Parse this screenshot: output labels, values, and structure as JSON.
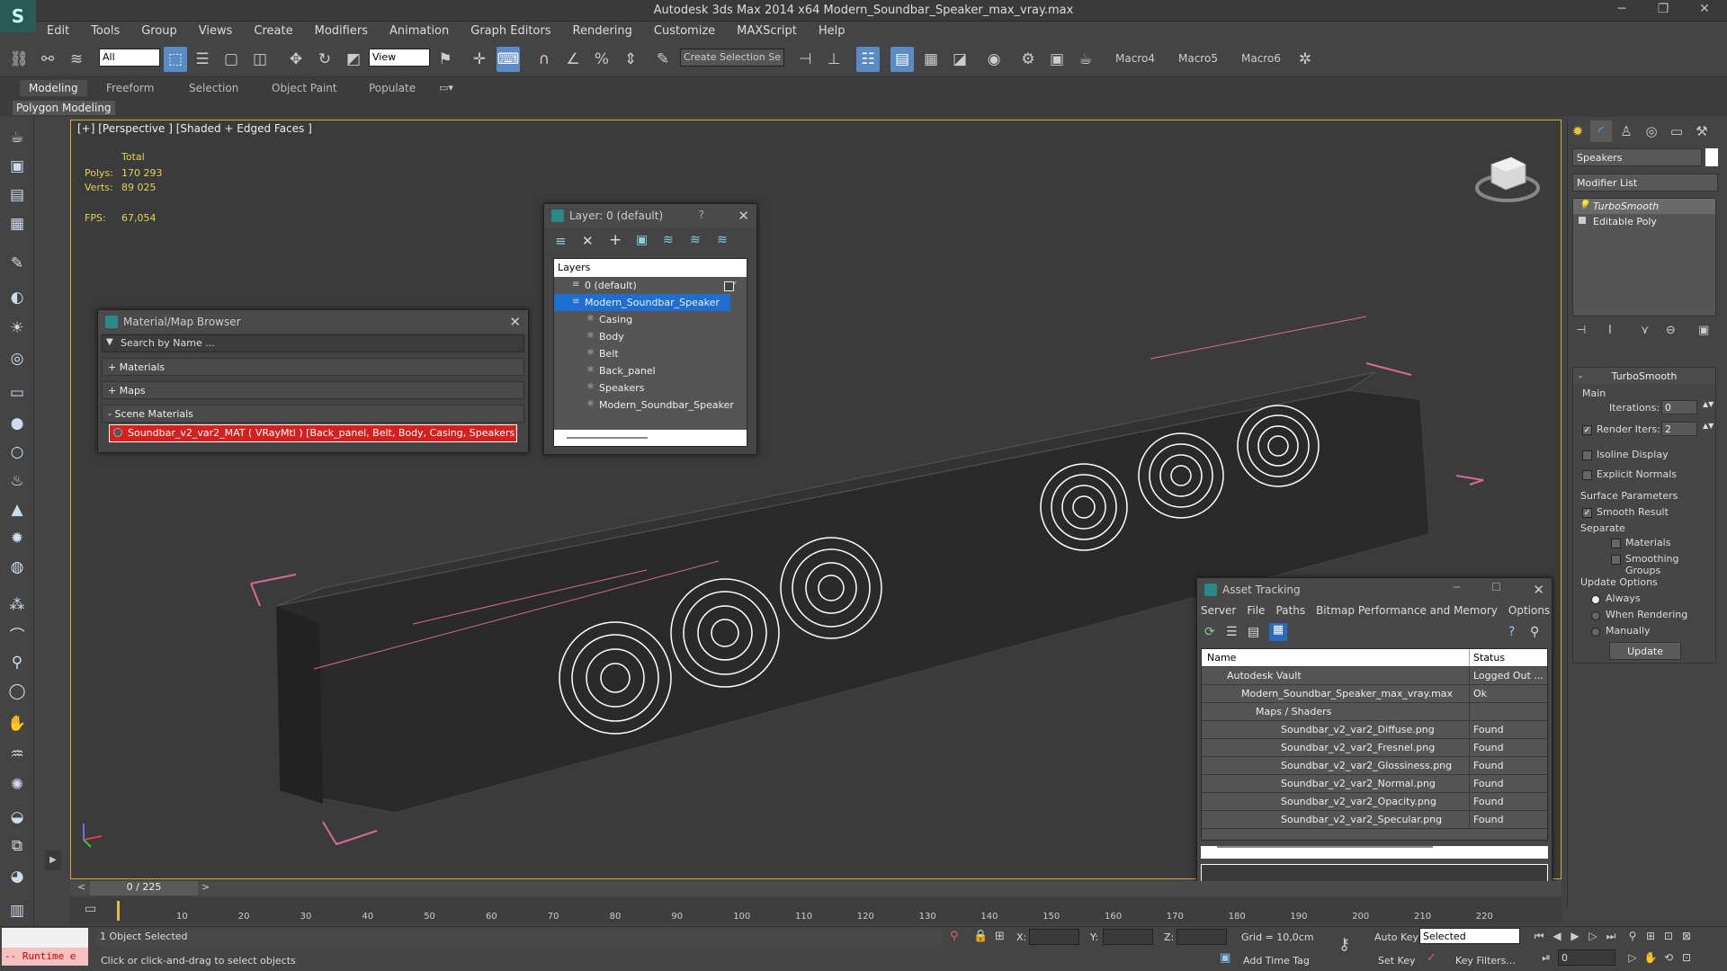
{
  "window": {
    "title": "Autodesk 3ds Max  2014 x64     Modern_Soundbar_Speaker_max_vray.max",
    "min": "─",
    "max": "❐",
    "close": "✕"
  },
  "menu": [
    "Edit",
    "Tools",
    "Group",
    "Views",
    "Create",
    "Modifiers",
    "Animation",
    "Graph Editors",
    "Rendering",
    "Customize",
    "MAXScript",
    "Help"
  ],
  "toolbar": {
    "filter_value": "All",
    "refcoord_value": "View",
    "selection_set_placeholder": "Create Selection Se",
    "macros": [
      "Macro4",
      "Macro5",
      "Macro6"
    ]
  },
  "ribbon": {
    "tabs": [
      "Modeling",
      "Freeform",
      "Selection",
      "Object Paint",
      "Populate"
    ],
    "active_tab": "Modeling",
    "sub_label": "Polygon Modeling"
  },
  "viewport": {
    "label": "[+] [Perspective ] [Shaded + Edged Faces ]",
    "stats": {
      "total_label": "Total",
      "polys_label": "Polys:",
      "polys_value": "170 293",
      "verts_label": "Verts:",
      "verts_value": "89 025",
      "fps_label": "FPS:",
      "fps_value": "67,054"
    }
  },
  "layer_dialog": {
    "title": "Layer: 0 (default)",
    "help": "?",
    "header": "Layers",
    "rows": [
      "0 (default)",
      "Modern_Soundbar_Speaker",
      "Casing",
      "Body",
      "Belt",
      "Back_panel",
      "Speakers",
      "Modern_Soundbar_Speaker"
    ],
    "check": "✓"
  },
  "material_browser": {
    "title": "Material/Map Browser",
    "search_placeholder": "Search by Name ...",
    "groups": [
      "+ Materials",
      "+ Maps",
      "- Scene Materials"
    ],
    "scene_material": "Soundbar_v2_var2_MAT  ( VRayMtl )  [Back_panel, Belt, Body, Casing, Speakers]"
  },
  "asset_tracking": {
    "title": "Asset Tracking",
    "menu": [
      "Server",
      "File",
      "Paths",
      "Bitmap Performance and Memory",
      "Options"
    ],
    "col_name": "Name",
    "col_status": "Status",
    "rows": [
      {
        "name": "Autodesk Vault",
        "status": "Logged Out ..."
      },
      {
        "name": "Modern_Soundbar_Speaker_max_vray.max",
        "status": "Ok"
      },
      {
        "name": "Maps / Shaders",
        "status": ""
      },
      {
        "name": "Soundbar_v2_var2_Diffuse.png",
        "status": "Found"
      },
      {
        "name": "Soundbar_v2_var2_Fresnel.png",
        "status": "Found"
      },
      {
        "name": "Soundbar_v2_var2_Glossiness.png",
        "status": "Found"
      },
      {
        "name": "Soundbar_v2_var2_Normal.png",
        "status": "Found"
      },
      {
        "name": "Soundbar_v2_var2_Opacity.png",
        "status": "Found"
      },
      {
        "name": "Soundbar_v2_var2_Specular.png",
        "status": "Found"
      }
    ]
  },
  "command_panel": {
    "object_name": "Speakers",
    "modifier_list": "Modifier List",
    "stack": [
      "TurboSmooth",
      "Editable Poly"
    ],
    "turbosmooth": {
      "title": "TurboSmooth",
      "main_label": "Main",
      "iterations_label": "Iterations:",
      "iterations_value": "0",
      "render_iters_label": "Render Iters:",
      "render_iters_value": "2",
      "isoline": "Isoline Display",
      "explicit_normals": "Explicit Normals",
      "surface_params": "Surface Parameters",
      "smooth_result": "Smooth Result",
      "separate": "Separate",
      "materials": "Materials",
      "smoothing_groups": "Smoothing Groups",
      "update_options": "Update Options",
      "always": "Always",
      "when_rendering": "When Rendering",
      "manually": "Manually",
      "update_button": "Update"
    }
  },
  "timeline": {
    "frame": "0 / 225",
    "ticks": [
      "10",
      "20",
      "30",
      "40",
      "50",
      "60",
      "70",
      "80",
      "90",
      "100",
      "110",
      "120",
      "130",
      "140",
      "150",
      "160",
      "170",
      "180",
      "190",
      "200",
      "210",
      "220"
    ]
  },
  "status": {
    "script_listener": "-- Runtime e",
    "selected": "1 Object Selected",
    "prompt": "Click or click-and-drag to select objects",
    "x_label": "X:",
    "y_label": "Y:",
    "z_label": "Z:",
    "grid": "Grid = 10,0cm",
    "add_time_tag": "Add Time Tag",
    "auto_key": "Auto Key",
    "set_key": "Set Key",
    "selected_dropdown": "Selected",
    "key_filters": "Key Filters...",
    "frame_value": "0"
  }
}
